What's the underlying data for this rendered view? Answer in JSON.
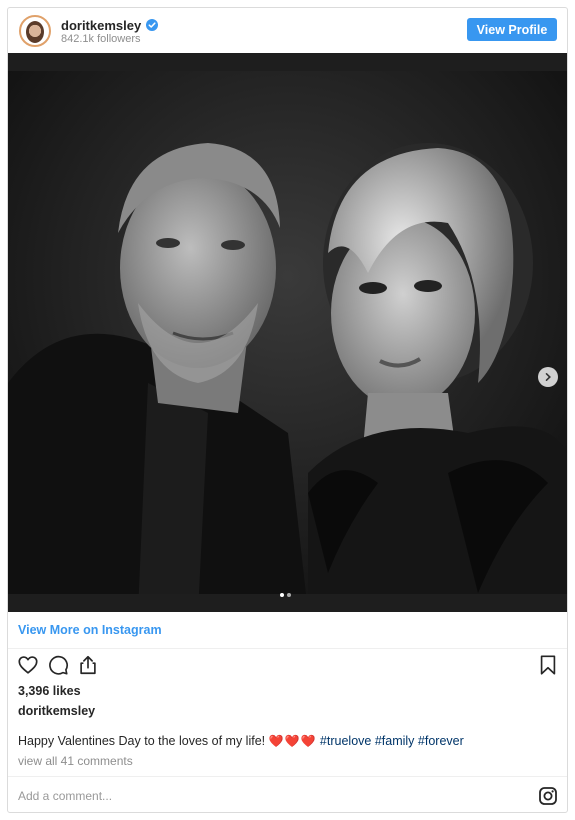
{
  "header": {
    "username": "doritkemsley",
    "followers": "842.1k followers",
    "view_profile_label": "View Profile"
  },
  "photo": {
    "carousel_dots": 2,
    "active_dot": 0
  },
  "view_more_label": "View More on Instagram",
  "likes": "3,396 likes",
  "post_author": "doritkemsley",
  "caption": {
    "text": "Happy Valentines Day to the loves of my life!",
    "hearts": "❤️❤️❤️",
    "hashtags": [
      "#truelove",
      "#family",
      "#forever"
    ]
  },
  "comments_link": "view all 41 comments",
  "add_comment_placeholder": "Add a comment...",
  "colors": {
    "accent": "#3897f0",
    "hashtag": "#003569",
    "muted": "#8e8e8e"
  },
  "icons": [
    "verified-badge-icon",
    "heart-icon",
    "comment-icon",
    "share-icon",
    "bookmark-icon",
    "chevron-right-icon",
    "instagram-logo-icon"
  ]
}
